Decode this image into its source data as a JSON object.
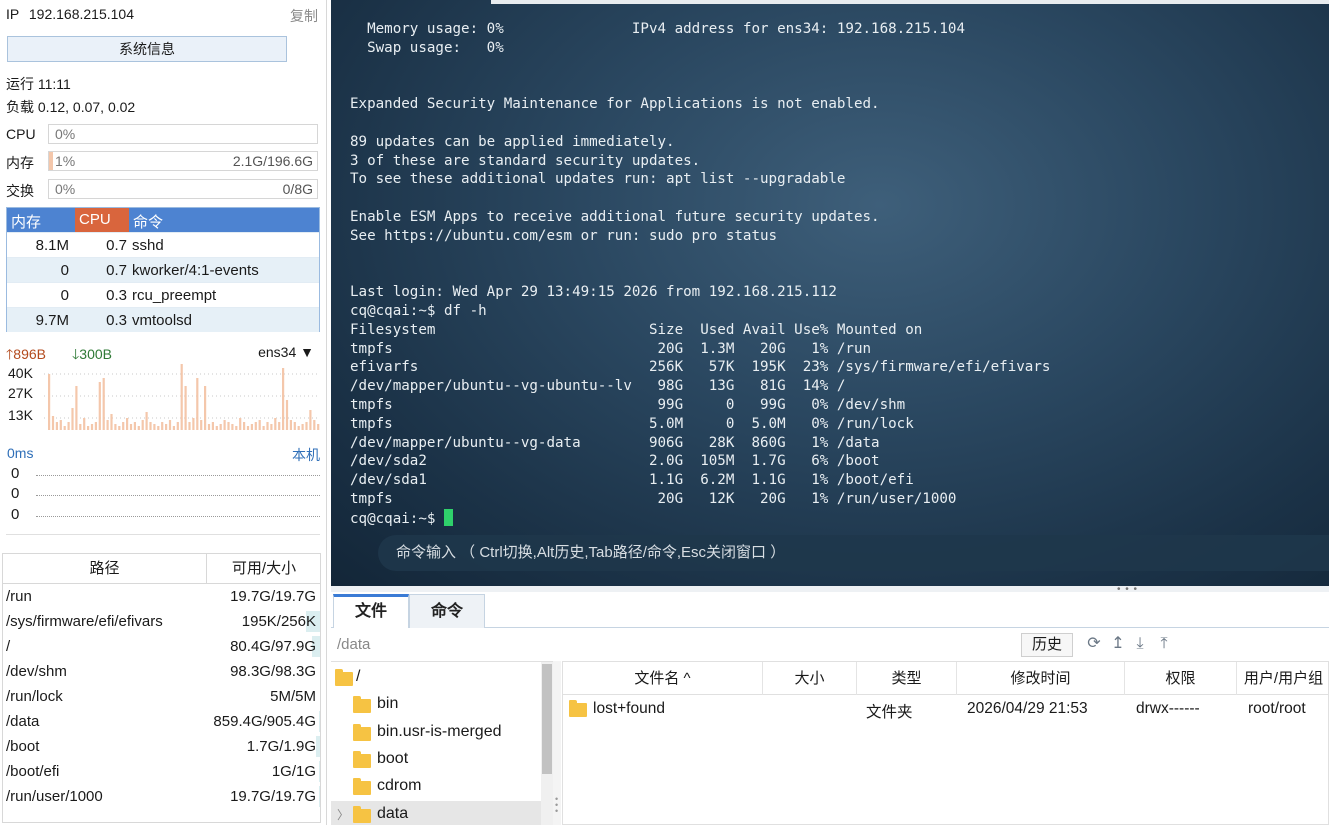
{
  "left": {
    "ip_label": "IP",
    "ip": "192.168.215.104",
    "copy": "复制",
    "sysinfo_button": "系统信息",
    "uptime": "运行 11:11",
    "load": "负载 0.12, 0.07, 0.02",
    "cpu": {
      "label": "CPU",
      "pct": "0%",
      "total": "",
      "fraction": 0.0
    },
    "mem": {
      "label": "内存",
      "pct": "1%",
      "total": "2.1G/196.6G",
      "fraction": 0.01
    },
    "swap": {
      "label": "交换",
      "pct": "0%",
      "total": "0/8G",
      "fraction": 0.0
    },
    "proc_headers": {
      "mem": "内存",
      "cpu": "CPU",
      "cmd": "命令"
    },
    "processes": [
      {
        "mem": "8.1M",
        "cpu": "0.7",
        "cmd": "sshd"
      },
      {
        "mem": "0",
        "cpu": "0.7",
        "cmd": "kworker/4:1-events"
      },
      {
        "mem": "0",
        "cpu": "0.3",
        "cmd": "rcu_preempt"
      },
      {
        "mem": "9.7M",
        "cpu": "0.3",
        "cmd": "vmtoolsd"
      }
    ],
    "net": {
      "up": "896B",
      "down": "300B",
      "iface": "ens34",
      "y_labels": [
        "40K",
        "27K",
        "13K"
      ]
    },
    "ping": {
      "latency": "0ms",
      "target": "本机",
      "values": [
        "0",
        "0",
        "0"
      ]
    },
    "disk_headers": {
      "path": "路径",
      "size": "可用/大小"
    },
    "disks": [
      {
        "path": "/run",
        "size": "19.7G/19.7G",
        "used": 0.0
      },
      {
        "path": "/sys/firmware/efi/efivars",
        "size": "195K/256K",
        "used": 0.23
      },
      {
        "path": "/",
        "size": "80.4G/97.9G",
        "used": 0.14
      },
      {
        "path": "/dev/shm",
        "size": "98.3G/98.3G",
        "used": 0.0
      },
      {
        "path": "/run/lock",
        "size": "5M/5M",
        "used": 0.0
      },
      {
        "path": "/data",
        "size": "859.4G/905.4G",
        "used": 0.01
      },
      {
        "path": "/boot",
        "size": "1.7G/1.9G",
        "used": 0.06
      },
      {
        "path": "/boot/efi",
        "size": "1G/1G",
        "used": 0.01
      },
      {
        "path": "/run/user/1000",
        "size": "19.7G/19.7G",
        "used": 0.01
      }
    ]
  },
  "terminal": {
    "text": "  Memory usage: 0%               IPv4 address for ens34: 192.168.215.104\n  Swap usage:   0%\n\n\nExpanded Security Maintenance for Applications is not enabled.\n\n89 updates can be applied immediately.\n3 of these are standard security updates.\nTo see these additional updates run: apt list --upgradable\n\nEnable ESM Apps to receive additional future security updates.\nSee https://ubuntu.com/esm or run: sudo pro status\n\n\nLast login: Wed Apr 29 13:49:15 2026 from 192.168.215.112\ncq@cqai:~$ df -h\nFilesystem                         Size  Used Avail Use% Mounted on\ntmpfs                               20G  1.3M   20G   1% /run\nefivarfs                           256K   57K  195K  23% /sys/firmware/efi/efivars\n/dev/mapper/ubuntu--vg-ubuntu--lv   98G   13G   81G  14% /\ntmpfs                               99G     0   99G   0% /dev/shm\ntmpfs                              5.0M     0  5.0M   0% /run/lock\n/dev/mapper/ubuntu--vg-data        906G   28K  860G   1% /data\n/dev/sda2                          2.0G  105M  1.7G   6% /boot\n/dev/sda1                          1.1G  6.2M  1.1G   1% /boot/efi\ntmpfs                               20G   12K   20G   1% /run/user/1000\n",
    "prompt": "cq@cqai:~$ ",
    "cmd_hint": "命令输入 （ Ctrl切换,Alt历史,Tab路径/命令,Esc关闭窗口 ）"
  },
  "files": {
    "tabs": [
      "文件",
      "命令"
    ],
    "path": "/data",
    "history_button": "历史",
    "tree": [
      {
        "label": "/",
        "level": 0
      },
      {
        "label": "bin",
        "level": 1
      },
      {
        "label": "bin.usr-is-merged",
        "level": 1
      },
      {
        "label": "boot",
        "level": 1
      },
      {
        "label": "cdrom",
        "level": 1
      },
      {
        "label": "data",
        "level": 1
      }
    ],
    "columns": [
      "文件名 ^",
      "大小",
      "类型",
      "修改时间",
      "权限",
      "用户/用户组"
    ],
    "rows": [
      {
        "name": "lost+found",
        "size": "",
        "type": "文件夹",
        "mtime": "2026/04/29 21:53",
        "perm": "drwx------",
        "owner": "root/root"
      }
    ]
  },
  "colors": {
    "accent": "#4d83d1",
    "cpu_header": "#d9653d",
    "net_bar": "#f4c7ab",
    "folder": "#f6c343",
    "cursor": "#2fd16b"
  }
}
